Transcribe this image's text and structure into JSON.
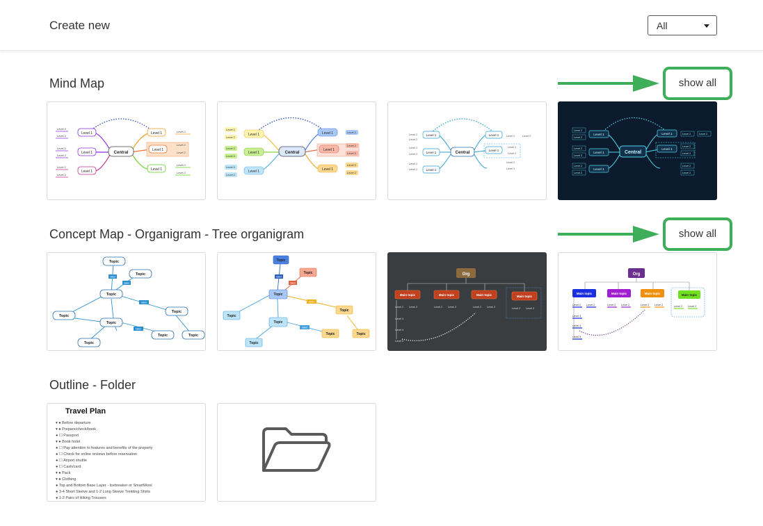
{
  "header": {
    "title": "Create new",
    "filter_value": "All"
  },
  "sections": [
    {
      "title": "Mind Map",
      "show_all": "show all"
    },
    {
      "title": "Concept Map - Organigram - Tree organigram",
      "show_all": "show all"
    },
    {
      "title": "Outline - Folder"
    }
  ],
  "colors": {
    "highlight_green": "#3fae5a",
    "navy_bg": "#0c1a2e",
    "dark_gray_bg": "#3a3d3f",
    "org_brown": "#8b6a3e",
    "org_purple": "#6b2f91"
  },
  "thumb": {
    "central": "Central",
    "level1": "Level 1",
    "level2": "Level 2",
    "level3": "Level 3",
    "level4": "Level 4",
    "level5": "Level 5",
    "topic": "Topic",
    "label": "label",
    "org": "Org",
    "main_topic": "Main topic"
  },
  "outline": {
    "title": "Travel Plan",
    "items": [
      "▾ ● Before departure",
      "    ▾ ● Prepare/check/book",
      "        ● ☐ Passport",
      "      ▾ ● Book hotel",
      "            ● ☐ Pay attention to features and benefits of the property",
      "            ● ☐ Check for online reviews before reservation",
      "        ● ☐ Airport shuttle",
      "        ● ☐ Cash/card",
      "▾ ● Pack",
      "    ▾ ● Clothing",
      "            ● Top and Bottom Base Layer - Icebreaker or SmartWool",
      "            ● 3-4 Short Sleeve and 1-2 Long Sleeve Trekking Shirts",
      "            ● 1-2 Pairs of Hiking Trousers"
    ]
  },
  "icons": {
    "folder": "folder-icon",
    "caret": "caret-down-icon",
    "arrow": "arrow-right-icon"
  }
}
